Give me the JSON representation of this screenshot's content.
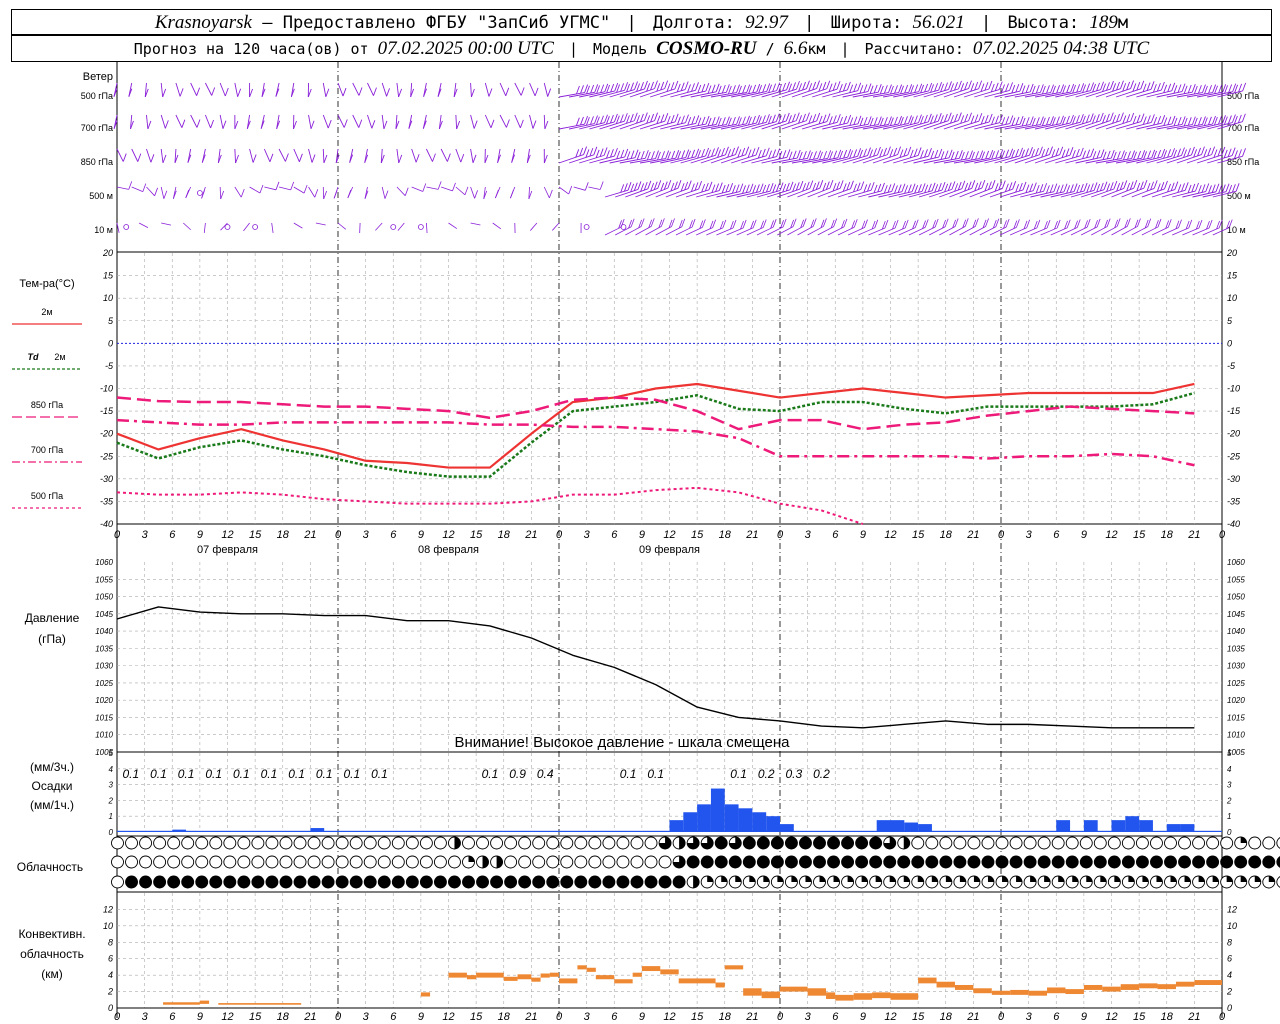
{
  "header": {
    "city": "Krasnoyarsk",
    "dash": "–",
    "provider": "Предоставлено ФГБУ \"ЗапСиб УГМС\"",
    "lon_label": "Долгота:",
    "lon": "92.97",
    "lat_label": "Широта:",
    "lat": "56.021",
    "alt_label": "Высота:",
    "alt": "189",
    "alt_unit": "м",
    "forecast_prefix": "Прогноз на 120 часа(ов) от",
    "forecast_date": "07.02.2025 00:00 UTC",
    "model_label": "Модель",
    "model": "COSMO-RU",
    "model_res": "6.6",
    "model_res_unit": "км",
    "calc_label": "Рассчитано:",
    "calc_date": "07.02.2025 04:38 UTC"
  },
  "chart_data": [
    {
      "type": "wind_barbs",
      "panel_title": "Ветер",
      "levels": [
        "500 гПа",
        "700 гПа",
        "850 гПа",
        "500 м",
        "10  м"
      ],
      "color": "#8a1fd8"
    },
    {
      "type": "line",
      "ylabel": "Тем-ра(°C)",
      "ylim": [
        -40,
        20
      ],
      "yticks": [
        20,
        15,
        10,
        5,
        0,
        -5,
        -10,
        -15,
        -20,
        -25,
        -30,
        -35,
        -40
      ],
      "x_hours": [
        0,
        3,
        6,
        9,
        12,
        15,
        18,
        21,
        24,
        27,
        30,
        33,
        36,
        39,
        42,
        45,
        48,
        51,
        54,
        57,
        60,
        63,
        66,
        69,
        72,
        75,
        78
      ],
      "series": [
        {
          "name": "2м",
          "color": "#ee3333",
          "values": [
            -20,
            -23.5,
            -21,
            -19,
            -21.5,
            -23.5,
            -26,
            -26.5,
            -27.5,
            -27.5,
            -20,
            -13,
            -12,
            -10,
            -9,
            -10.5,
            -12,
            -11,
            -10,
            -11,
            -12,
            -11.5,
            -11,
            -11,
            -11,
            -11,
            -9
          ]
        },
        {
          "name": "Td 2м",
          "color": "#1a7a1a",
          "values": [
            -22,
            -25.5,
            -23,
            -21.5,
            -23.5,
            -25,
            -27,
            -28.5,
            -29.5,
            -29.5,
            -22,
            -15,
            -14,
            -13,
            -11.5,
            -14.5,
            -15,
            -13,
            -13,
            -14.5,
            -15.5,
            -14,
            -14,
            -14,
            -14,
            -13.5,
            -11
          ]
        },
        {
          "name": "850 гПа",
          "color": "#ee1a7a",
          "values": [
            -12,
            -12.8,
            -13,
            -13,
            -13.5,
            -14,
            -14,
            -14.5,
            -15,
            -16.5,
            -15,
            -12.5,
            -12,
            -12.5,
            -15,
            -19,
            -17,
            -17,
            -19,
            -18,
            -17.5,
            -16,
            -15,
            -14,
            -14.5,
            -15,
            -15.5
          ]
        },
        {
          "name": "700 гПа",
          "color": "#ee1a7a",
          "values": [
            -17,
            -17.5,
            -18,
            -18,
            -17.5,
            -17.5,
            -17.5,
            -17.5,
            -17.5,
            -18,
            -18,
            -18.5,
            -18.5,
            -19,
            -19.5,
            -21,
            -25,
            -25,
            -25,
            -25,
            -25,
            -25.5,
            -25,
            -25,
            -24.5,
            -25,
            -27
          ]
        },
        {
          "name": "500 гПа",
          "color": "#ee1a7a",
          "values": [
            -33,
            -33.5,
            -33.5,
            -33,
            -33.5,
            -34.5,
            -35,
            -35.5,
            -35.5,
            -35.5,
            -35,
            -33.5,
            -33.5,
            -32.5,
            -32,
            -33,
            -35.5,
            -37,
            -40
          ]
        }
      ]
    },
    {
      "type": "line",
      "ylabel": "Давление",
      "unit": "(гПа)",
      "ylim": [
        1005,
        1060
      ],
      "x_hours": [
        0,
        3,
        6,
        9,
        12,
        15,
        18,
        21,
        24,
        27,
        30,
        33,
        36,
        39,
        42,
        45,
        48,
        51,
        54,
        57,
        60,
        63,
        66,
        69,
        72,
        75,
        78
      ],
      "series": [
        {
          "name": "",
          "color": "#000000",
          "values": [
            1043.5,
            1047,
            1045.5,
            1045,
            1045,
            1044.5,
            1044.5,
            1043,
            1043,
            1041.5,
            1038,
            1033,
            1029.5,
            1024.5,
            1018,
            1015,
            1014,
            1012.5,
            1012,
            1013,
            1014,
            1013,
            1013,
            1012.5,
            1012,
            1012,
            1012
          ]
        }
      ],
      "note": "Внимание! Высокое давление - шкала смещена"
    },
    {
      "type": "bar",
      "ylabel_top": "(мм/3ч.)",
      "ylabel": "Осадки",
      "ylabel_bottom": "(мм/1ч.)",
      "ylim": [
        0,
        5
      ],
      "color": "#2255ee",
      "labels": [
        {
          "hour": 1.5,
          "text": "0.1"
        },
        {
          "hour": 4.5,
          "text": "0.1"
        },
        {
          "hour": 7.5,
          "text": "0.1"
        },
        {
          "hour": 10.5,
          "text": "0.1"
        },
        {
          "hour": 13.5,
          "text": "0.1"
        },
        {
          "hour": 16.5,
          "text": "0.1"
        },
        {
          "hour": 19.5,
          "text": "0.1"
        },
        {
          "hour": 22.5,
          "text": "0.1"
        },
        {
          "hour": 25.5,
          "text": "0.1"
        },
        {
          "hour": 28.5,
          "text": "0.1"
        },
        {
          "hour": 40.5,
          "text": "0.1"
        },
        {
          "hour": 43.5,
          "text": "0.9"
        },
        {
          "hour": 46.5,
          "text": "0.4"
        },
        {
          "hour": 55.5,
          "text": "0.1"
        },
        {
          "hour": 58.5,
          "text": "0.1"
        },
        {
          "hour": 67.5,
          "text": "0.1"
        },
        {
          "hour": 70.5,
          "text": "0.2"
        },
        {
          "hour": 73.5,
          "text": "0.3"
        },
        {
          "hour": 76.5,
          "text": "0.2"
        }
      ],
      "hourly": [
        [
          4,
          0.03
        ],
        [
          14,
          0.05
        ],
        [
          40,
          0.15
        ],
        [
          41,
          0.25
        ],
        [
          42,
          0.35
        ],
        [
          43,
          0.55
        ],
        [
          44,
          0.35
        ],
        [
          45,
          0.3
        ],
        [
          46,
          0.25
        ],
        [
          47,
          0.2
        ],
        [
          48,
          0.1
        ],
        [
          55,
          0.15
        ],
        [
          56,
          0.15
        ],
        [
          57,
          0.12
        ],
        [
          58,
          0.1
        ],
        [
          68,
          0.15
        ],
        [
          70,
          0.15
        ],
        [
          72,
          0.15
        ],
        [
          73,
          0.2
        ],
        [
          74,
          0.15
        ],
        [
          76,
          0.1
        ],
        [
          77,
          0.1
        ]
      ]
    },
    {
      "type": "cloud_cover",
      "label": "Облачность",
      "rows": [
        "высокая",
        "средняя",
        "низкая"
      ],
      "high": [
        0,
        0,
        0,
        0,
        0,
        0,
        0,
        0,
        0,
        0,
        0,
        0,
        0,
        0,
        0,
        0,
        0,
        0,
        0,
        0,
        0,
        0,
        0,
        0,
        0,
        0,
        0,
        0,
        0,
        0,
        0,
        0,
        0,
        0,
        0,
        0,
        0,
        0,
        0,
        0,
        0,
        0,
        0,
        0,
        0,
        0,
        0,
        2,
        2,
        1,
        0,
        0,
        0,
        0,
        0,
        0,
        0,
        0,
        0,
        0,
        0,
        0,
        0,
        0,
        0,
        0,
        0,
        0,
        0,
        0,
        0,
        0,
        0,
        0,
        0,
        0,
        0,
        0,
        3,
        3,
        2,
        3,
        3,
        3,
        3,
        4,
        4,
        4,
        3,
        4,
        4,
        4,
        4,
        4,
        4,
        4,
        4,
        4,
        4,
        4,
        4,
        4,
        4,
        4,
        4,
        4,
        4,
        4,
        4,
        3,
        3,
        2,
        2,
        0,
        0,
        0,
        0,
        0,
        0,
        0,
        0,
        0,
        0,
        0,
        0,
        0,
        0,
        0,
        0,
        0,
        0,
        0,
        0,
        0,
        0,
        0,
        0,
        0,
        0,
        0,
        0,
        0,
        0,
        0,
        0,
        0,
        0,
        0,
        0,
        0,
        0,
        0,
        0,
        0,
        0,
        0,
        0,
        0,
        0,
        1,
        1,
        0,
        0,
        0,
        0,
        0,
        0,
        2,
        2,
        0,
        0,
        1,
        1,
        2,
        2,
        2,
        2,
        2,
        2,
        3,
        3,
        3,
        3,
        3,
        3
      ],
      "mid": [
        0,
        0,
        0,
        0,
        0,
        0,
        0,
        0,
        0,
        0,
        0,
        0,
        0,
        0,
        0,
        0,
        0,
        0,
        0,
        0,
        0,
        0,
        0,
        0,
        0,
        0,
        0,
        0,
        0,
        0,
        0,
        0,
        0,
        0,
        0,
        0,
        0,
        0,
        0,
        0,
        0,
        0,
        0,
        0,
        0,
        0,
        0,
        0,
        0,
        0,
        1,
        2,
        2,
        2,
        2,
        2,
        0,
        0,
        0,
        0,
        0,
        0,
        0,
        0,
        0,
        0,
        0,
        0,
        0,
        0,
        0,
        0,
        0,
        0,
        0,
        0,
        0,
        0,
        0,
        1,
        3,
        4,
        4,
        3,
        4,
        4,
        4,
        4,
        4,
        4,
        4,
        4,
        4,
        4,
        4,
        4,
        4,
        4,
        4,
        4,
        4,
        4,
        4,
        4,
        4,
        4,
        4,
        4,
        4,
        4,
        4,
        4,
        4,
        4,
        4,
        4,
        4,
        4,
        4,
        4,
        4,
        4,
        4,
        4,
        4,
        4,
        4,
        4,
        4,
        4,
        4,
        2,
        4,
        4,
        4,
        4,
        4,
        4,
        4,
        4,
        4,
        4,
        4,
        4,
        4,
        4,
        4,
        4,
        4,
        4,
        4,
        4,
        4,
        4,
        4,
        4,
        4,
        4,
        4,
        4,
        4,
        4,
        4,
        4,
        4,
        4,
        4,
        4,
        4,
        4,
        4,
        4,
        4,
        4,
        4,
        4,
        4,
        4,
        4,
        4,
        4,
        4,
        3
      ],
      "low": [
        0,
        0,
        4,
        4,
        4,
        4,
        4,
        4,
        4,
        4,
        4,
        4,
        4,
        4,
        4,
        4,
        4,
        4,
        4,
        4,
        4,
        4,
        4,
        4,
        4,
        4,
        4,
        4,
        4,
        4,
        4,
        4,
        4,
        4,
        4,
        4,
        4,
        4,
        4,
        4,
        4,
        4,
        4,
        4,
        4,
        4,
        4,
        4,
        4,
        4,
        4,
        4,
        4,
        4,
        4,
        4,
        4,
        4,
        4,
        4,
        4,
        4,
        4,
        4,
        4,
        4,
        4,
        4,
        4,
        4,
        4,
        4,
        4,
        4,
        4,
        4,
        4,
        4,
        4,
        4,
        4,
        4,
        2,
        1,
        1,
        1,
        1,
        1,
        1,
        1,
        1,
        1,
        1,
        1,
        1,
        1,
        1,
        1,
        1,
        1,
        1,
        1,
        1,
        1,
        1,
        1,
        1,
        1,
        1,
        1,
        1,
        1,
        1,
        1,
        1,
        1,
        1,
        1,
        1,
        1,
        1,
        1,
        1,
        1,
        1,
        1,
        1,
        1,
        1,
        1,
        1,
        1,
        1,
        1,
        1,
        1,
        1,
        1,
        1,
        1,
        1,
        1,
        1,
        1,
        1,
        1,
        1,
        1,
        1,
        1,
        1,
        1,
        1,
        1,
        1,
        1,
        1,
        1,
        1,
        1,
        1,
        1,
        1,
        1,
        1,
        1,
        1,
        1,
        1,
        1,
        1,
        1,
        1,
        1,
        1,
        1,
        1,
        1,
        1,
        1,
        1,
        2,
        4
      ]
    },
    {
      "type": "bar",
      "ylabel": "Конвективн. облачность",
      "unit": "(км)",
      "ylim": [
        0,
        14
      ],
      "yticks": [
        0,
        2,
        4,
        6,
        8,
        10,
        12
      ],
      "color": "#ee8833",
      "segments": [
        [
          5,
          9,
          0.4,
          0.7
        ],
        [
          9,
          10,
          0.5,
          0.9
        ],
        [
          11,
          20,
          0.4,
          0.6
        ],
        [
          33,
          34,
          1.4,
          1.9
        ],
        [
          36,
          38,
          3.7,
          4.3
        ],
        [
          38,
          39,
          3.5,
          4.0
        ],
        [
          39,
          42,
          3.7,
          4.3
        ],
        [
          42,
          43.5,
          3.3,
          3.8
        ],
        [
          43.5,
          45,
          3.5,
          4.1
        ],
        [
          45,
          46,
          3.2,
          3.7
        ],
        [
          46,
          47,
          3.7,
          4.2
        ],
        [
          47,
          48,
          3.8,
          4.3
        ],
        [
          48,
          50,
          3.0,
          3.6
        ],
        [
          50,
          51,
          4.7,
          5.2
        ],
        [
          51,
          52,
          4.4,
          4.9
        ],
        [
          52,
          54,
          3.5,
          4.0
        ],
        [
          54,
          56,
          3.0,
          3.5
        ],
        [
          56,
          57,
          3.8,
          4.3
        ],
        [
          57,
          59,
          4.5,
          5.1
        ],
        [
          59,
          61,
          4.1,
          4.7
        ],
        [
          61,
          65,
          3.0,
          3.6
        ],
        [
          65,
          66,
          2.5,
          3.1
        ],
        [
          66,
          68,
          4.7,
          5.2
        ],
        [
          68,
          70,
          1.5,
          2.4
        ],
        [
          70,
          72,
          1.2,
          2.0
        ],
        [
          72,
          75,
          2.0,
          2.6
        ],
        [
          75,
          77,
          1.5,
          2.4
        ],
        [
          77,
          78,
          1.1,
          1.9
        ],
        [
          78,
          80,
          0.9,
          1.6
        ],
        [
          80,
          82,
          1.0,
          1.8
        ],
        [
          82,
          84,
          1.2,
          1.9
        ],
        [
          84,
          87,
          1.0,
          1.8
        ],
        [
          87,
          89,
          3.0,
          3.7
        ],
        [
          89,
          91,
          2.5,
          3.2
        ],
        [
          91,
          93,
          2.2,
          2.8
        ],
        [
          93,
          95,
          1.8,
          2.4
        ],
        [
          95,
          97,
          1.6,
          2.1
        ],
        [
          97,
          99,
          1.6,
          2.2
        ],
        [
          99,
          101,
          1.5,
          2.1
        ],
        [
          101,
          103,
          1.8,
          2.5
        ],
        [
          103,
          105,
          1.7,
          2.3
        ],
        [
          105,
          107,
          2.2,
          2.8
        ],
        [
          107,
          109,
          2.0,
          2.6
        ],
        [
          109,
          111,
          2.2,
          2.9
        ],
        [
          111,
          113,
          2.4,
          3.0
        ],
        [
          113,
          115,
          2.3,
          2.9
        ],
        [
          115,
          117,
          2.6,
          3.2
        ],
        [
          117,
          120,
          2.8,
          3.4
        ]
      ]
    }
  ],
  "x_axis": {
    "tick_labels": [
      "0",
      "3",
      "6",
      "9",
      "12",
      "15",
      "18",
      "21"
    ],
    "day_labels": [
      "07 февраля",
      "08 февраля",
      "09 февраля"
    ]
  },
  "legend": {
    "t2m": "2м",
    "td": "Td",
    "td_suffix": "2м",
    "p850": "850 гПа",
    "p700": "700 гПа",
    "p500": "500 гПа"
  }
}
